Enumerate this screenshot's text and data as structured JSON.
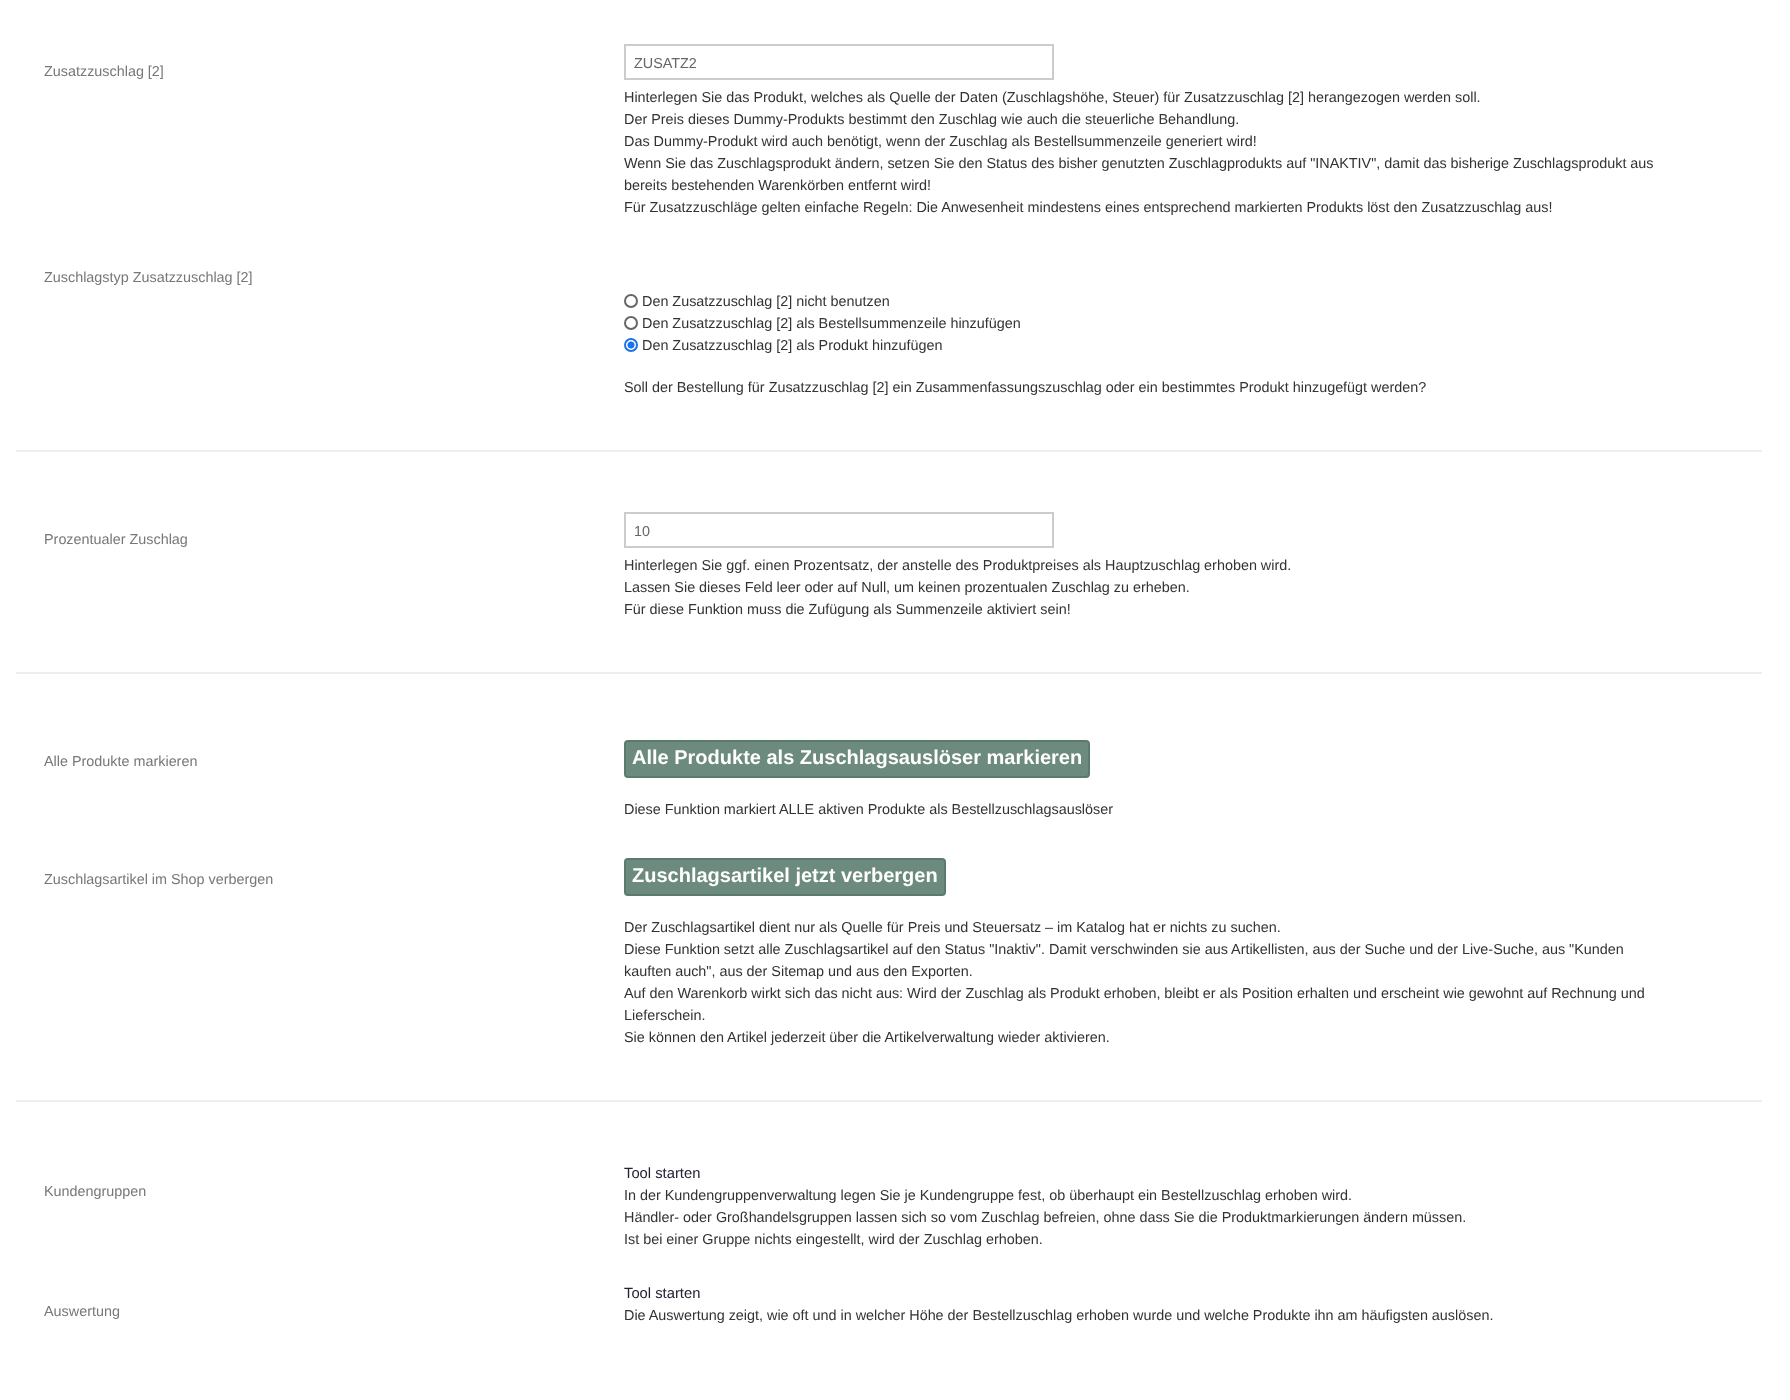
{
  "sections": [
    {
      "rows": [
        {
          "kind": "field",
          "label": "Zusatzzuschlag [2]",
          "value": "ZUSATZ2",
          "description": [
            "Hinterlegen Sie das Produkt, welches als Quelle der Daten (Zuschlagshöhe, Steuer) für Zusatzzuschlag [2] herangezogen werden soll.",
            "Der Preis dieses Dummy-Produkts bestimmt den Zuschlag wie auch die steuerliche Behandlung.",
            "Das Dummy-Produkt wird auch benötigt, wenn der Zuschlag als Bestellsummenzeile generiert wird!",
            "Wenn Sie das Zuschlagsprodukt ändern, setzen Sie den Status des bisher genutzten Zuschlagprodukts auf \"INAKTIV\", damit das bisherige Zuschlagsprodukt aus bereits bestehenden Warenkörben entfernt wird!",
            "Für Zusatzzuschläge gelten einfache Regeln: Die Anwesenheit mindestens eines entsprechend markierten Produkts löst den Zusatzzuschlag aus!"
          ]
        },
        {
          "kind": "radios",
          "label": "Zuschlagstyp Zusatzzuschlag [2]",
          "options": [
            {
              "label": "Den Zusatzzuschlag [2] nicht benutzen",
              "selected": false
            },
            {
              "label": "Den Zusatzzuschlag [2] als Bestellsummenzeile hinzufügen",
              "selected": false
            },
            {
              "label": "Den Zusatzzuschlag [2] als Produkt hinzufügen",
              "selected": true
            }
          ],
          "description": [
            "Soll der Bestellung für Zusatzzuschlag [2] ein Zusammenfassungszuschlag oder ein bestimmtes Produkt hinzugefügt werden?"
          ]
        }
      ]
    },
    {
      "rows": [
        {
          "kind": "field",
          "label": "Prozentualer Zuschlag",
          "value": "10",
          "description": [
            "Hinterlegen Sie ggf. einen Prozentsatz, der anstelle des Produktpreises als Hauptzuschlag erhoben wird.",
            "Lassen Sie dieses Feld leer oder auf Null, um keinen prozentualen Zuschlag zu erheben.",
            "Für diese Funktion muss die Zufügung als Summenzeile aktiviert sein!"
          ]
        }
      ]
    },
    {
      "rows": [
        {
          "kind": "button",
          "label": "Alle Produkte markieren",
          "button": "Alle Produkte als Zuschlagsauslöser markieren",
          "description": [
            "Diese Funktion markiert ALLE aktiven Produkte als Bestellzuschlagsauslöser"
          ]
        },
        {
          "kind": "button",
          "label": "Zuschlagsartikel im Shop verbergen",
          "button": "Zuschlagsartikel jetzt verbergen",
          "description": [
            "Der Zuschlagsartikel dient nur als Quelle für Preis und Steuersatz – im Katalog hat er nichts zu suchen.",
            "Diese Funktion setzt alle Zuschlagsartikel auf den Status \"Inaktiv\". Damit verschwinden sie aus Artikellisten, aus der Suche und der Live-Suche, aus \"Kunden kauften auch\", aus der Sitemap und aus den Exporten.",
            "Auf den Warenkorb wirkt sich das nicht aus: Wird der Zuschlag als Produkt erhoben, bleibt er als Position erhalten und erscheint wie gewohnt auf Rechnung und Lieferschein.",
            "Sie können den Artikel jederzeit über die Artikelverwaltung wieder aktivieren."
          ]
        }
      ]
    },
    {
      "rows": [
        {
          "kind": "tool",
          "label": "Kundengruppen",
          "link": "Tool starten",
          "description": [
            "In der Kundengruppenverwaltung legen Sie je Kundengruppe fest, ob überhaupt ein Bestellzuschlag erhoben wird.",
            "Händler- oder Großhandelsgruppen lassen sich so vom Zuschlag befreien, ohne dass Sie die Produktmarkierungen ändern müssen.",
            "Ist bei einer Gruppe nichts eingestellt, wird der Zuschlag erhoben."
          ]
        },
        {
          "kind": "tool",
          "label": "Auswertung",
          "link": "Tool starten",
          "description": [
            "Die Auswertung zeigt, wie oft und in welcher Höhe der Bestellzuschlag erhoben wurde und welche Produkte ihn am häufigsten auslösen."
          ]
        }
      ]
    }
  ]
}
